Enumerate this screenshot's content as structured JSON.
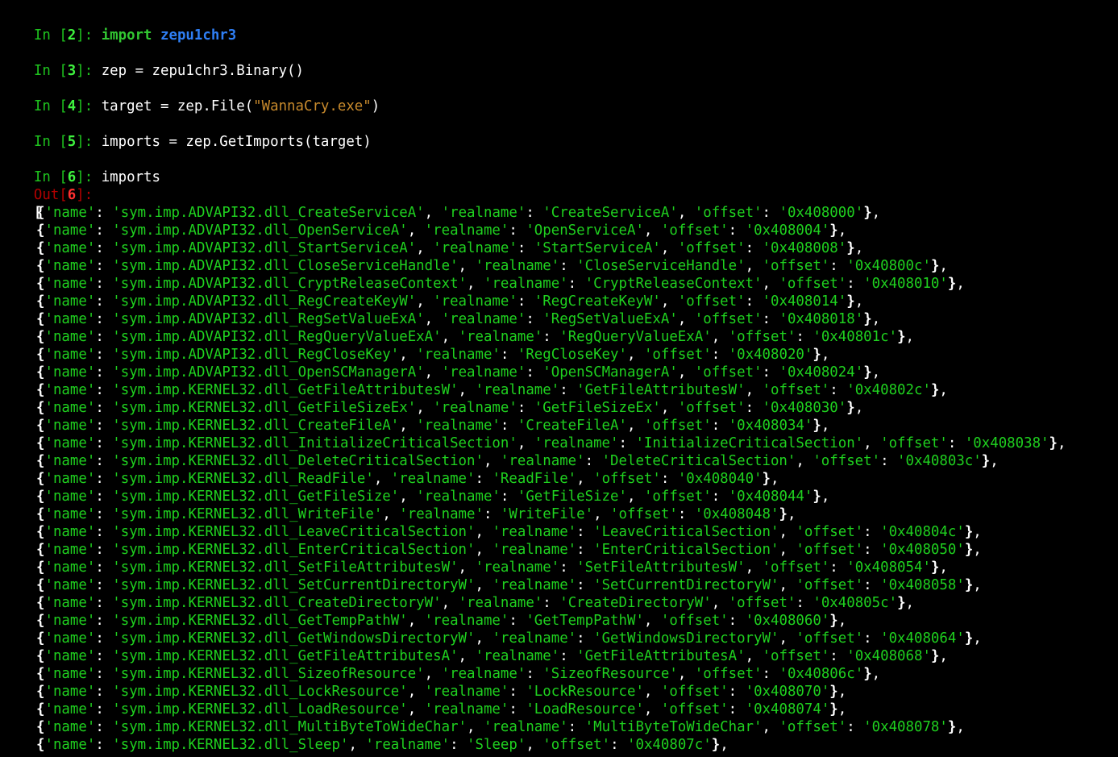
{
  "session": {
    "cells": [
      {
        "in_label": "In ",
        "in_bracket_open": "[",
        "number": "2",
        "in_bracket_close": "]: ",
        "keyword": "import",
        "module": "zepu1chr3"
      },
      {
        "in_label": "In ",
        "in_bracket_open": "[",
        "number": "3",
        "in_bracket_close": "]: ",
        "code": "zep = zepu1chr3.Binary()"
      },
      {
        "in_label": "In ",
        "in_bracket_open": "[",
        "number": "4",
        "in_bracket_close": "]: ",
        "code_before": "target = zep.File(",
        "string": "\"WannaCry.exe\"",
        "code_after": ")"
      },
      {
        "in_label": "In ",
        "in_bracket_open": "[",
        "number": "5",
        "in_bracket_close": "]: ",
        "code": "imports = zep.GetImports(target)"
      },
      {
        "in_label": "In ",
        "in_bracket_open": "[",
        "number": "6",
        "in_bracket_close": "]: ",
        "code": "imports"
      }
    ],
    "output": {
      "out_label": "Out",
      "out_bracket_open": "[",
      "number": "6",
      "out_bracket_close": "]:",
      "list_open": "[",
      "keys": {
        "name": "'name'",
        "realname": "'realname'",
        "offset": "'offset'"
      },
      "records": [
        {
          "name": "'sym.imp.ADVAPI32.dll_CreateServiceA'",
          "realname": "'CreateServiceA'",
          "offset": "'0x408000'"
        },
        {
          "name": "'sym.imp.ADVAPI32.dll_OpenServiceA'",
          "realname": "'OpenServiceA'",
          "offset": "'0x408004'"
        },
        {
          "name": "'sym.imp.ADVAPI32.dll_StartServiceA'",
          "realname": "'StartServiceA'",
          "offset": "'0x408008'"
        },
        {
          "name": "'sym.imp.ADVAPI32.dll_CloseServiceHandle'",
          "realname": "'CloseServiceHandle'",
          "offset": "'0x40800c'"
        },
        {
          "name": "'sym.imp.ADVAPI32.dll_CryptReleaseContext'",
          "realname": "'CryptReleaseContext'",
          "offset": "'0x408010'"
        },
        {
          "name": "'sym.imp.ADVAPI32.dll_RegCreateKeyW'",
          "realname": "'RegCreateKeyW'",
          "offset": "'0x408014'"
        },
        {
          "name": "'sym.imp.ADVAPI32.dll_RegSetValueExA'",
          "realname": "'RegSetValueExA'",
          "offset": "'0x408018'"
        },
        {
          "name": "'sym.imp.ADVAPI32.dll_RegQueryValueExA'",
          "realname": "'RegQueryValueExA'",
          "offset": "'0x40801c'"
        },
        {
          "name": "'sym.imp.ADVAPI32.dll_RegCloseKey'",
          "realname": "'RegCloseKey'",
          "offset": "'0x408020'"
        },
        {
          "name": "'sym.imp.ADVAPI32.dll_OpenSCManagerA'",
          "realname": "'OpenSCManagerA'",
          "offset": "'0x408024'"
        },
        {
          "name": "'sym.imp.KERNEL32.dll_GetFileAttributesW'",
          "realname": "'GetFileAttributesW'",
          "offset": "'0x40802c'"
        },
        {
          "name": "'sym.imp.KERNEL32.dll_GetFileSizeEx'",
          "realname": "'GetFileSizeEx'",
          "offset": "'0x408030'"
        },
        {
          "name": "'sym.imp.KERNEL32.dll_CreateFileA'",
          "realname": "'CreateFileA'",
          "offset": "'0x408034'"
        },
        {
          "name": "'sym.imp.KERNEL32.dll_InitializeCriticalSection'",
          "realname": "'InitializeCriticalSection'",
          "offset": "'0x408038'"
        },
        {
          "name": "'sym.imp.KERNEL32.dll_DeleteCriticalSection'",
          "realname": "'DeleteCriticalSection'",
          "offset": "'0x40803c'"
        },
        {
          "name": "'sym.imp.KERNEL32.dll_ReadFile'",
          "realname": "'ReadFile'",
          "offset": "'0x408040'"
        },
        {
          "name": "'sym.imp.KERNEL32.dll_GetFileSize'",
          "realname": "'GetFileSize'",
          "offset": "'0x408044'"
        },
        {
          "name": "'sym.imp.KERNEL32.dll_WriteFile'",
          "realname": "'WriteFile'",
          "offset": "'0x408048'"
        },
        {
          "name": "'sym.imp.KERNEL32.dll_LeaveCriticalSection'",
          "realname": "'LeaveCriticalSection'",
          "offset": "'0x40804c'"
        },
        {
          "name": "'sym.imp.KERNEL32.dll_EnterCriticalSection'",
          "realname": "'EnterCriticalSection'",
          "offset": "'0x408050'"
        },
        {
          "name": "'sym.imp.KERNEL32.dll_SetFileAttributesW'",
          "realname": "'SetFileAttributesW'",
          "offset": "'0x408054'"
        },
        {
          "name": "'sym.imp.KERNEL32.dll_SetCurrentDirectoryW'",
          "realname": "'SetCurrentDirectoryW'",
          "offset": "'0x408058'"
        },
        {
          "name": "'sym.imp.KERNEL32.dll_CreateDirectoryW'",
          "realname": "'CreateDirectoryW'",
          "offset": "'0x40805c'"
        },
        {
          "name": "'sym.imp.KERNEL32.dll_GetTempPathW'",
          "realname": "'GetTempPathW'",
          "offset": "'0x408060'"
        },
        {
          "name": "'sym.imp.KERNEL32.dll_GetWindowsDirectoryW'",
          "realname": "'GetWindowsDirectoryW'",
          "offset": "'0x408064'"
        },
        {
          "name": "'sym.imp.KERNEL32.dll_GetFileAttributesA'",
          "realname": "'GetFileAttributesA'",
          "offset": "'0x408068'"
        },
        {
          "name": "'sym.imp.KERNEL32.dll_SizeofResource'",
          "realname": "'SizeofResource'",
          "offset": "'0x40806c'"
        },
        {
          "name": "'sym.imp.KERNEL32.dll_LockResource'",
          "realname": "'LockResource'",
          "offset": "'0x408070'"
        },
        {
          "name": "'sym.imp.KERNEL32.dll_LoadResource'",
          "realname": "'LoadResource'",
          "offset": "'0x408074'"
        },
        {
          "name": "'sym.imp.KERNEL32.dll_MultiByteToWideChar'",
          "realname": "'MultiByteToWideChar'",
          "offset": "'0x408078'"
        },
        {
          "name": "'sym.imp.KERNEL32.dll_Sleep'",
          "realname": "'Sleep'",
          "offset": "'0x40807c'"
        }
      ]
    }
  },
  "colors": {
    "background": "#000000",
    "in_prompt": "#1ec21e",
    "out_prompt": "#b30000",
    "keyword": "#32c832",
    "module": "#2f7ff5",
    "string_literal": "#c88a2c",
    "output_string": "#1fd11f",
    "text": "#ffffff"
  }
}
